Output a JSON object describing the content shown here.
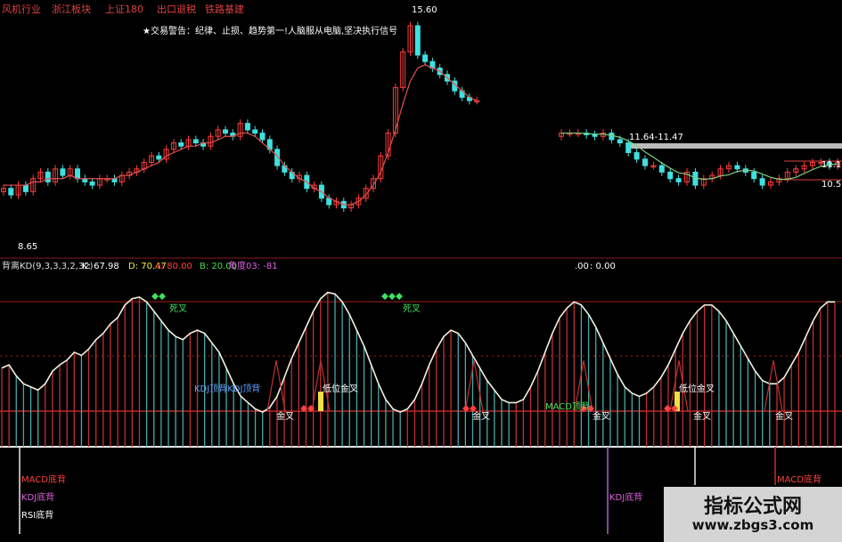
{
  "header": {
    "sector_tabs": [
      "风机行业",
      "浙江板块",
      "上证180",
      "出口退税",
      "铁路基建"
    ],
    "warning": "★交易警告：纪律、止损、趋势第一!人脑服从电脑,坚决执行信号"
  },
  "price_labels": {
    "high": "15.60",
    "low": "8.65",
    "range": "11.64-11.47",
    "right_high": "11.1",
    "right_low": "10.5"
  },
  "indicator_header": {
    "name": "背离KD(9,3,3,3,2,32)",
    "k": "K: 67.98",
    "d": "D: 70.47",
    "a": "A: 80.00",
    "b": "B: 20.00",
    "angle": "角度03: -81",
    "mid_readout": ".00",
    "mid_readout2": ": 0.00"
  },
  "annotations": {
    "top_cross_1": "死叉",
    "top_cross_2": "死叉",
    "kdj_top": "KDJ顶背KDJ顶背",
    "macd_top": "MACD顶背",
    "low_gold_1": "低位金叉",
    "low_gold_2": "低位金叉",
    "gold_cross": "金叉"
  },
  "bottom_signals": {
    "macd_bottom_1": "MACD底背",
    "kdj_bottom_1": "KDJ底背",
    "rsi_bottom": "RSI底背",
    "kdj_bottom_2": "KDJ底背",
    "macd_bottom_2": "MACD底背"
  },
  "watermark": {
    "title": "指标公式网",
    "url": "www.zbgs3.com"
  },
  "colors": {
    "up": "#ff3b3b",
    "down": "#3fe0e0",
    "ma": "#e05050",
    "ma2": "#7fd07f",
    "k_line": "#f0f0e0",
    "hist_up": "#c03030",
    "hist_down": "#4aa8a8"
  },
  "chart_data": [
    {
      "type": "candlestick",
      "title": "",
      "close": [
        10.3,
        10.1,
        10.4,
        10.2,
        10.6,
        10.8,
        10.5,
        10.9,
        10.7,
        10.9,
        10.6,
        10.5,
        10.4,
        10.6,
        10.6,
        10.5,
        10.7,
        10.8,
        10.9,
        11.1,
        11.3,
        11.2,
        11.5,
        11.7,
        11.6,
        11.8,
        11.7,
        11.6,
        11.9,
        12.1,
        12.0,
        11.9,
        12.3,
        12.1,
        12.0,
        11.8,
        11.5,
        11.0,
        10.8,
        10.6,
        10.7,
        10.3,
        10.4,
        10.0,
        9.8,
        9.9,
        9.7,
        9.8,
        10.0,
        10.3,
        10.6,
        11.3,
        12.0,
        13.4,
        14.5,
        15.3,
        14.4,
        14.2,
        14.0,
        13.8,
        13.6,
        13.3,
        13.1,
        13.0,
        13.0
      ],
      "ma": [
        10.4,
        10.4,
        10.4,
        10.4,
        10.5,
        10.5,
        10.6,
        10.6,
        10.6,
        10.7,
        10.6,
        10.6,
        10.6,
        10.6,
        10.6,
        10.6,
        10.7,
        10.7,
        10.8,
        10.9,
        11.0,
        11.1,
        11.3,
        11.4,
        11.5,
        11.6,
        11.6,
        11.7,
        11.7,
        11.8,
        11.9,
        11.9,
        12.0,
        12.0,
        11.9,
        11.7,
        11.5,
        11.3,
        11.0,
        10.8,
        10.6,
        10.5,
        10.3,
        10.2,
        10.0,
        9.9,
        9.8,
        9.8,
        9.9,
        10.1,
        10.4,
        10.8,
        11.4,
        12.1,
        12.9,
        13.6,
        14.0,
        14.1,
        14.0,
        13.9,
        13.7,
        13.5,
        13.3,
        13.1,
        13.0
      ],
      "close_right": [
        12.0,
        12.0,
        12.0,
        11.95,
        11.9,
        12.0,
        11.8,
        11.7,
        11.4,
        11.2,
        11.0,
        11.0,
        10.8,
        10.6,
        10.5,
        10.8,
        10.4,
        10.6,
        10.7,
        10.9,
        11.0,
        10.9,
        10.8,
        10.6,
        10.4,
        10.5,
        10.6,
        10.8,
        10.9,
        11.0,
        11.1,
        11.1,
        11.0,
        11.1
      ],
      "low_label": 8.65,
      "high_label": 15.6
    },
    {
      "type": "line",
      "title": "背离KD(9,3,3,3,2,32)",
      "series": [
        {
          "name": "K",
          "values": [
            50,
            52,
            45,
            40,
            38,
            36,
            40,
            48,
            52,
            55,
            60,
            58,
            62,
            68,
            72,
            78,
            82,
            90,
            94,
            95,
            92,
            86,
            80,
            74,
            70,
            68,
            72,
            74,
            72,
            66,
            60,
            50,
            40,
            32,
            28,
            24,
            22,
            25,
            32,
            44,
            56,
            66,
            76,
            86,
            94,
            98,
            97,
            92,
            84,
            74,
            64,
            52,
            40,
            30,
            24,
            22,
            24,
            30,
            40,
            52,
            62,
            70,
            74,
            72,
            66,
            58,
            50,
            42,
            36,
            30,
            28,
            28,
            30,
            38,
            48,
            60,
            72,
            82,
            88,
            92,
            90,
            84,
            76,
            66,
            56,
            46,
            38,
            34,
            32,
            34,
            38,
            44,
            52,
            62,
            72,
            80,
            86,
            90,
            90,
            86,
            80,
            72,
            64,
            56,
            48,
            42,
            40,
            40,
            44,
            52,
            60,
            70,
            80,
            88,
            92,
            92
          ]
        }
      ],
      "ylim": [
        0,
        100
      ],
      "a": 80,
      "b": 20
    }
  ]
}
